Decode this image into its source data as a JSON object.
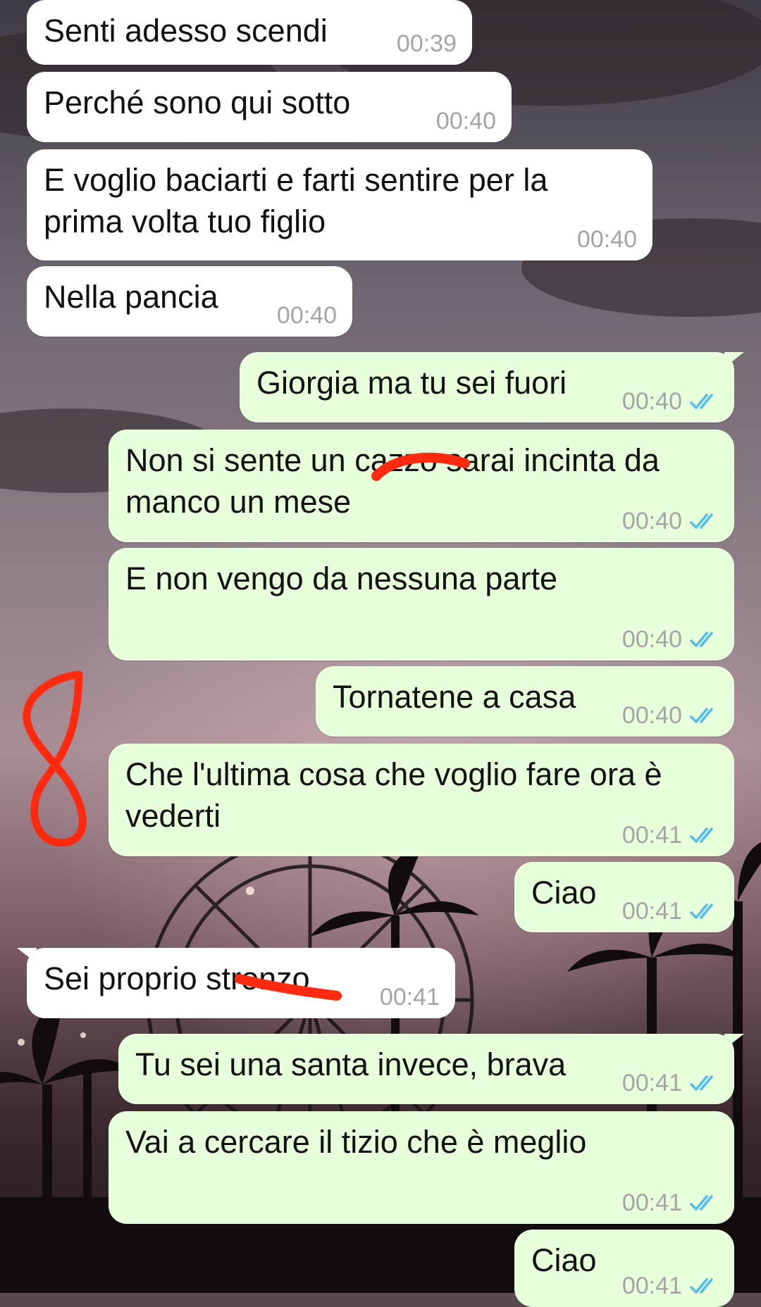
{
  "messages": [
    {
      "direction": "in",
      "text": "Senti adesso scendi",
      "time": "00:39"
    },
    {
      "direction": "in",
      "text": "Perché sono qui sotto",
      "time": "00:40"
    },
    {
      "direction": "in",
      "text": "E voglio baciarti e farti sentire per la\nprima volta tuo figlio",
      "time": "00:40"
    },
    {
      "direction": "in",
      "text": "Nella pancia",
      "time": "00:40"
    },
    {
      "direction": "out",
      "text": "Giorgia ma tu sei fuori",
      "time": "00:40",
      "status": "read"
    },
    {
      "direction": "out",
      "text": "Non si sente un cazzo sarai incinta da\nmanco un mese",
      "time": "00:40",
      "status": "read"
    },
    {
      "direction": "out",
      "text": "E non vengo da nessuna parte",
      "time": "00:40",
      "status": "read"
    },
    {
      "direction": "out",
      "text": "Tornatene a casa",
      "time": "00:40",
      "status": "read"
    },
    {
      "direction": "out",
      "text": "Che l'ultima cosa che voglio fare ora è\nvederti",
      "time": "00:41",
      "status": "read"
    },
    {
      "direction": "out",
      "text": "Ciao",
      "time": "00:41",
      "status": "read"
    },
    {
      "direction": "in",
      "text": "Sei proprio stronzo",
      "time": "00:41"
    },
    {
      "direction": "out",
      "text": "Tu sei una santa invece, brava",
      "time": "00:41",
      "status": "read"
    },
    {
      "direction": "out",
      "text": "Vai a cercare il tizio che è meglio",
      "time": "00:41",
      "status": "read"
    },
    {
      "direction": "out",
      "text": "Ciao",
      "time": "00:41",
      "status": "read"
    }
  ],
  "icons": {
    "read_receipt": "double-check-icon"
  },
  "colors": {
    "incoming_bubble": "#ffffff",
    "outgoing_bubble": "#e7ffdb",
    "timestamp": "#a4a4a4",
    "read_ticks": "#53bdeb",
    "annotation_red": "#ff2a10"
  }
}
